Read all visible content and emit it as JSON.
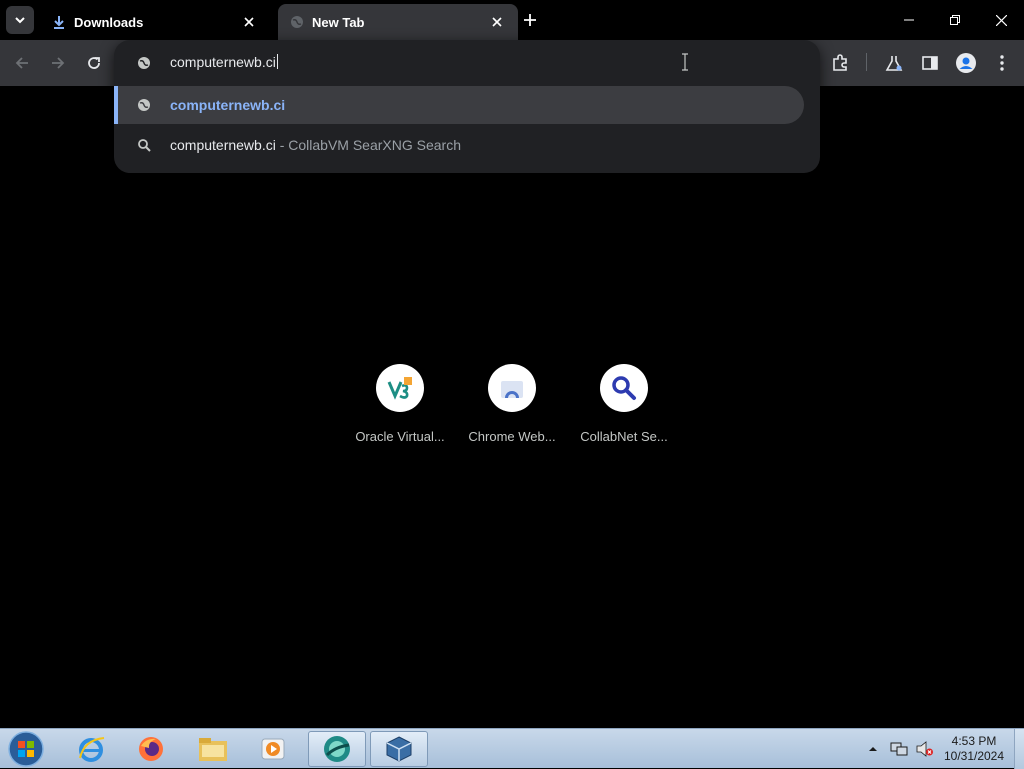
{
  "tabs": [
    {
      "title": "Downloads",
      "icon": "download-icon",
      "active": false
    },
    {
      "title": "New Tab",
      "icon": "globe-icon",
      "active": true
    }
  ],
  "omnibox": {
    "input_value": "computernewb.ci",
    "suggestions": [
      {
        "icon": "globe-icon",
        "text": "computernewb.ci",
        "desc": "",
        "selected": true
      },
      {
        "icon": "search-icon",
        "text": "computernewb.ci",
        "desc": " - CollabVM SearXNG Search",
        "selected": false
      }
    ]
  },
  "shortcuts": [
    {
      "label": "Oracle Virtual...",
      "icon": "virtualbox-icon"
    },
    {
      "label": "Chrome Web...",
      "icon": "chrome-web-store-icon"
    },
    {
      "label": "CollabNet Se...",
      "icon": "magnifier-icon"
    }
  ],
  "taskbar": {
    "clock_time": "4:53 PM",
    "clock_date": "10/31/2024"
  },
  "colors": {
    "accent": "#8ab4f8",
    "tab_active": "#35363a",
    "omnibox_bg": "#202124"
  }
}
